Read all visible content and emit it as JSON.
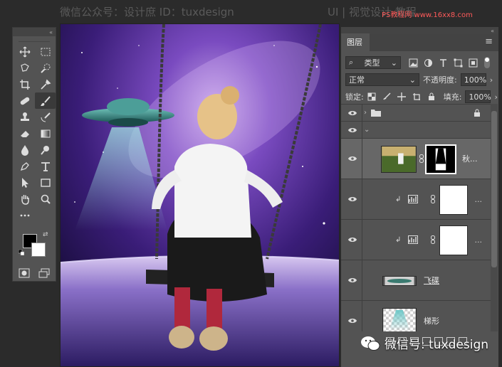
{
  "watermark": {
    "top_left": "微信公众号：设计庶 ID：tuxdesign",
    "top_right": "UI | 视觉设计 教程",
    "site": "PS教程网 www.16xx8.com",
    "wechat": "微信号: tuxdesign"
  },
  "toolbar": {
    "collapse": "«",
    "tools": [
      "move-icon",
      "marquee-icon",
      "lasso-icon",
      "quick-select-icon",
      "crop-icon",
      "eyedropper-icon",
      "healing-icon",
      "brush-icon",
      "stamp-icon",
      "history-brush-icon",
      "eraser-icon",
      "gradient-icon",
      "blur-icon",
      "dodge-icon",
      "pen-icon",
      "type-icon",
      "path-select-icon",
      "rectangle-icon",
      "hand-icon",
      "zoom-icon",
      "more-tools-icon"
    ],
    "active_tool": "brush-icon",
    "foreground_color": "#000000",
    "background_color": "#ffffff"
  },
  "layers_panel": {
    "collapse": "«",
    "tab": "图层",
    "filter_label": "类型",
    "blend_mode": "正常",
    "opacity_label": "不透明度:",
    "opacity_value": "100%",
    "lock_label": "锁定:",
    "fill_label": "填充:",
    "fill_value": "100%",
    "layers": [
      {
        "kind": "group",
        "name": "",
        "locked": true,
        "expanded": false
      },
      {
        "kind": "group-open",
        "name": ""
      },
      {
        "kind": "image-mask",
        "name": "秋...",
        "selected": true
      },
      {
        "kind": "adjustment",
        "name": "...",
        "clipped": true
      },
      {
        "kind": "adjustment",
        "name": "...",
        "clipped": true
      },
      {
        "kind": "image",
        "name": "飞碟"
      },
      {
        "kind": "image",
        "name": "梯形"
      }
    ]
  },
  "colors": {
    "panel_bg": "#535353",
    "selected_layer": "#676767",
    "canvas_space_dark": "#1c0f3a",
    "canvas_space_purple": "#6a3fb0"
  }
}
